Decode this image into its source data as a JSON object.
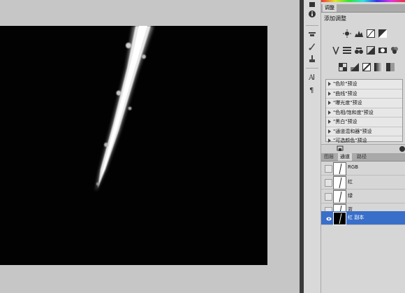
{
  "document": {
    "content": "black canvas with white streak"
  },
  "panels": {
    "adjustments": {
      "tab_label": "调整",
      "title": "添加调整",
      "presets": [
        "\"色阶\"预设",
        "\"曲线\"预设",
        "\"曝光度\"预设",
        "\"色相/饱和度\"预设",
        "\"黑白\"预设",
        "\"通道混和器\"预设",
        "\"可选颜色\"预设"
      ]
    },
    "layers_tabs": [
      "图层",
      "通道",
      "路径"
    ],
    "channels": [
      {
        "name": "RGB",
        "visible": false,
        "selected": false
      },
      {
        "name": "红",
        "visible": false,
        "selected": false
      },
      {
        "name": "绿",
        "visible": false,
        "selected": false
      },
      {
        "name": "蓝",
        "visible": false,
        "selected": false
      },
      {
        "name": "红 副本",
        "visible": true,
        "selected": true
      }
    ]
  },
  "icons": {
    "strip": [
      "layers-icon",
      "info-icon",
      "tools-icon",
      "brush-presets-icon",
      "clone-source-icon",
      "character-icon",
      "paragraph-icon"
    ],
    "adjustments": [
      "brightness-icon",
      "levels-icon",
      "curves-icon",
      "exposure-icon",
      "vibrance-icon",
      "hue-saturation-icon",
      "color-balance-icon",
      "black-white-icon",
      "photo-filter-icon",
      "channel-mixer-icon",
      "invert-icon",
      "posterize-icon",
      "threshold-icon",
      "gradient-map-icon",
      "selective-color-icon"
    ]
  },
  "colors": {
    "selection": "#3a6fc9",
    "panel": "#d6d6d6",
    "canvas_bg": "#c6c6c6",
    "document": "#020202"
  }
}
